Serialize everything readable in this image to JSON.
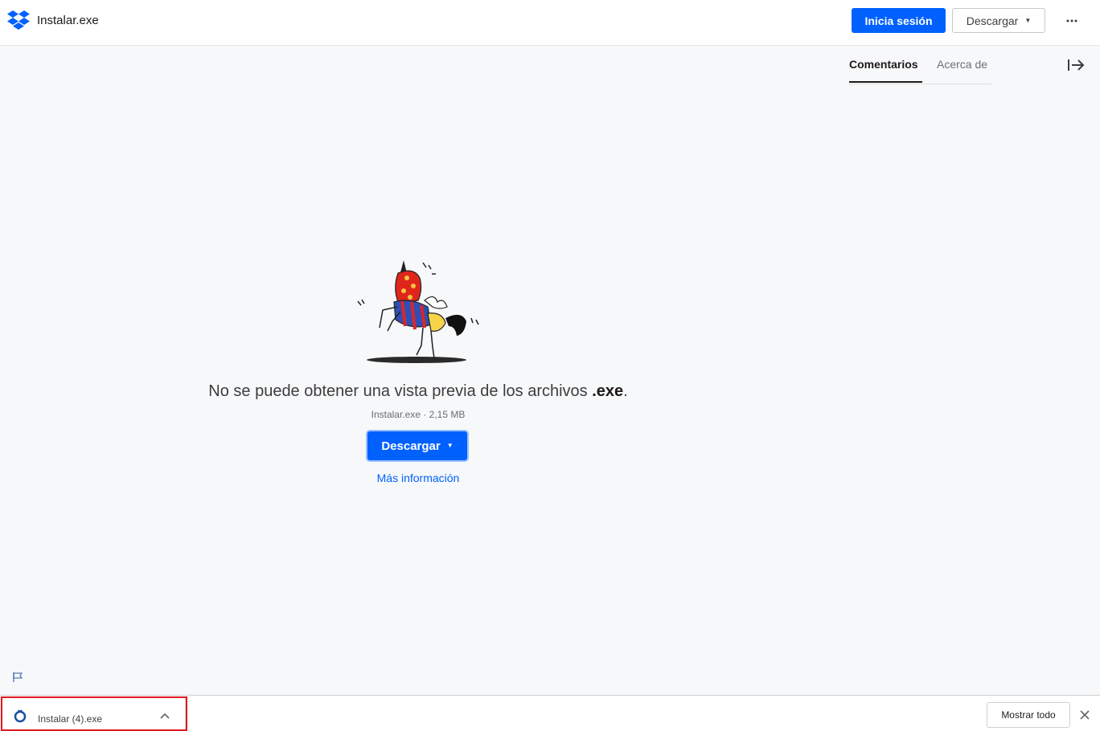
{
  "header": {
    "file_title": "Instalar.exe",
    "signin_label": "Inicia sesión",
    "download_label": "Descargar",
    "more_icon": "more-horizontal-icon"
  },
  "sidebar_tabs": [
    {
      "label": "Comentarios",
      "active": true
    },
    {
      "label": "Acerca de",
      "active": false
    }
  ],
  "preview": {
    "message_prefix": "No se puede obtener una vista previa de los archivos ",
    "message_ext": ".exe",
    "message_suffix": ".",
    "file_info": "Instalar.exe · 2,15 MB",
    "download_label": "Descargar",
    "more_info_label": "Más información"
  },
  "download_bar": {
    "item_name": "Instalar (4).exe",
    "show_all_label": "Mostrar todo"
  },
  "colors": {
    "brand_blue": "#0061fe",
    "highlight_red": "#e1191f"
  }
}
